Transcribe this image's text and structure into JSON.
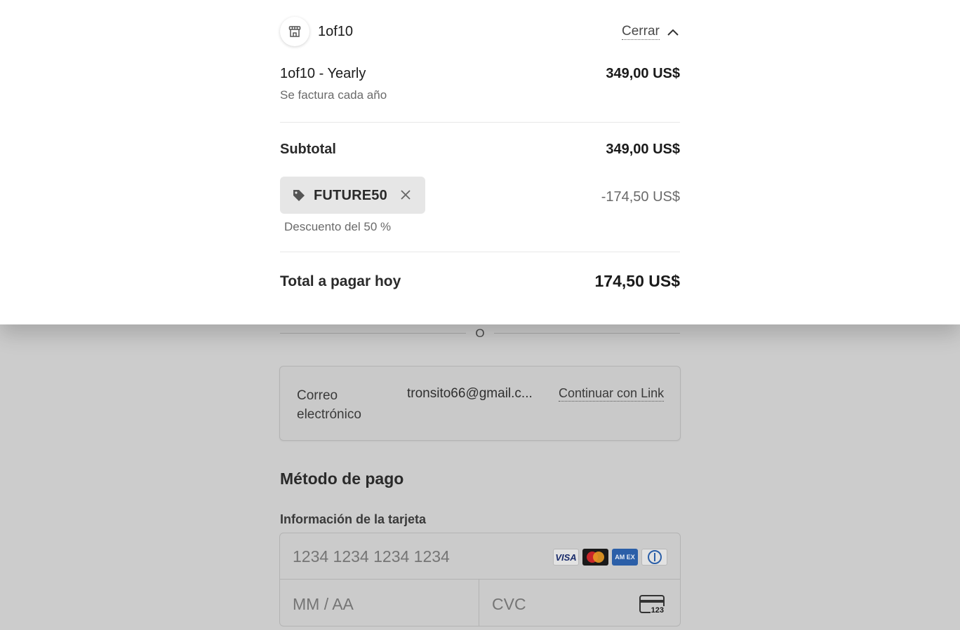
{
  "header": {
    "merchant_name": "1of10",
    "close_label": "Cerrar"
  },
  "summary": {
    "item_name": "1of10 - Yearly",
    "item_billing": "Se factura cada año",
    "item_price": "349,00 US$",
    "subtotal_label": "Subtotal",
    "subtotal_amount": "349,00 US$",
    "promo_code": "FUTURE50",
    "promo_description": "Descuento del 50 %",
    "discount_amount": "-174,50 US$",
    "total_label": "Total a pagar hoy",
    "total_amount": "174,50 US$"
  },
  "checkout": {
    "divider_text": "O",
    "email_label": "Correo electrónico",
    "email_value": "tronsito66@gmail.c...",
    "link_button": "Continuar con Link",
    "payment_method_title": "Método de pago",
    "card_info_label": "Información de la tarjeta",
    "card_number_placeholder": "1234 1234 1234 1234",
    "expiry_placeholder": "MM / AA",
    "cvc_placeholder": "CVC",
    "cvc_icon_text": "123",
    "brands": {
      "visa": "VISA",
      "amex": "AM EX"
    }
  },
  "colors": {
    "overlay_bg": "#ffffff",
    "dimmed_bg": "#cccccc",
    "chip_bg": "#e6e6e6",
    "amex_blue": "#2b5fa8"
  }
}
